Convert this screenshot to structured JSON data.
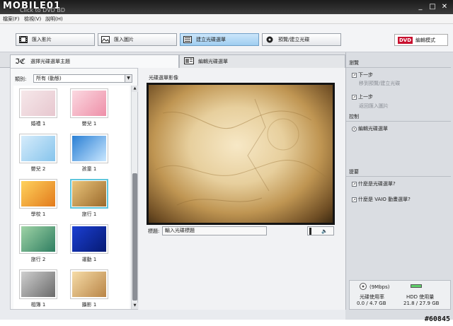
{
  "watermark": {
    "logo": "MOBILE01",
    "app_title": "Click to DVD BD",
    "id": "#60845"
  },
  "window_controls": {
    "minimize": "_",
    "maximize": "□",
    "close": "✕"
  },
  "menu": [
    "檔案(F)",
    "檢視(V)",
    "說明(H)"
  ],
  "steps": [
    {
      "label": "匯入影片",
      "icon": "film-icon"
    },
    {
      "label": "匯入圖片",
      "icon": "image-icon"
    },
    {
      "label": "建立光碟選單",
      "icon": "menu-icon"
    },
    {
      "label": "預覽/建立光碟",
      "icon": "disc-icon"
    }
  ],
  "mode_button": {
    "badge": "DVD",
    "label": "編輯模式"
  },
  "tabs": [
    {
      "label": "選擇光碟選單主題",
      "active": true
    },
    {
      "label": "編輯光碟選單",
      "active": false
    }
  ],
  "category": {
    "label": "類別:",
    "value": "所有 (動態)"
  },
  "thumbnails": [
    {
      "label": "婚禮 1",
      "colors": [
        "#f6e8ea",
        "#e7c7cf"
      ]
    },
    {
      "label": "嬰兒 1",
      "colors": [
        "#fbd9e1",
        "#ee8fa8"
      ]
    },
    {
      "label": "嬰兒 2",
      "colors": [
        "#d6ecfb",
        "#86c4ec"
      ]
    },
    {
      "label": "孩童 1",
      "colors": [
        "#2a7fd4",
        "#c9e7ff"
      ]
    },
    {
      "label": "學校 1",
      "colors": [
        "#ffd25c",
        "#e27a1c"
      ]
    },
    {
      "label": "旅行 1",
      "colors": [
        "#e9c47a",
        "#9b6a2c"
      ]
    },
    {
      "label": "旅行 2",
      "colors": [
        "#9fd3a6",
        "#2f7e61"
      ]
    },
    {
      "label": "運動 1",
      "colors": [
        "#1b3fd2",
        "#061a73"
      ]
    },
    {
      "label": "相簿 1",
      "colors": [
        "#cfcfcf",
        "#6a6a6a"
      ]
    },
    {
      "label": "攝影 1",
      "colors": [
        "#f6dca7",
        "#b98547"
      ]
    }
  ],
  "preview": {
    "label": "光碟選單影像"
  },
  "title_field": {
    "label": "標題:",
    "value": "輸入光碟標題"
  },
  "audio": {
    "icon": "speaker-icon",
    "glyph": "🔈"
  },
  "navigation": {
    "heading": "瀏覽",
    "next": {
      "label": "下一步",
      "sub": "移到預覽/建立光碟"
    },
    "back": {
      "label": "上一步",
      "sub": "返回匯入圖片"
    }
  },
  "control": {
    "heading": "控制",
    "item": "編輯光碟選單"
  },
  "tips": {
    "heading": "提要",
    "items": [
      "什麼是光碟選單?",
      "什麼是 VAIO 動畫選單?"
    ]
  },
  "status": {
    "speed": "(9Mbps)",
    "disc_label": "光碟使用率",
    "disc_value": "0.0 / 4.7 GB",
    "hdd_label": "HDD 使用量",
    "hdd_value": "21.8 / 27.9 GB"
  }
}
